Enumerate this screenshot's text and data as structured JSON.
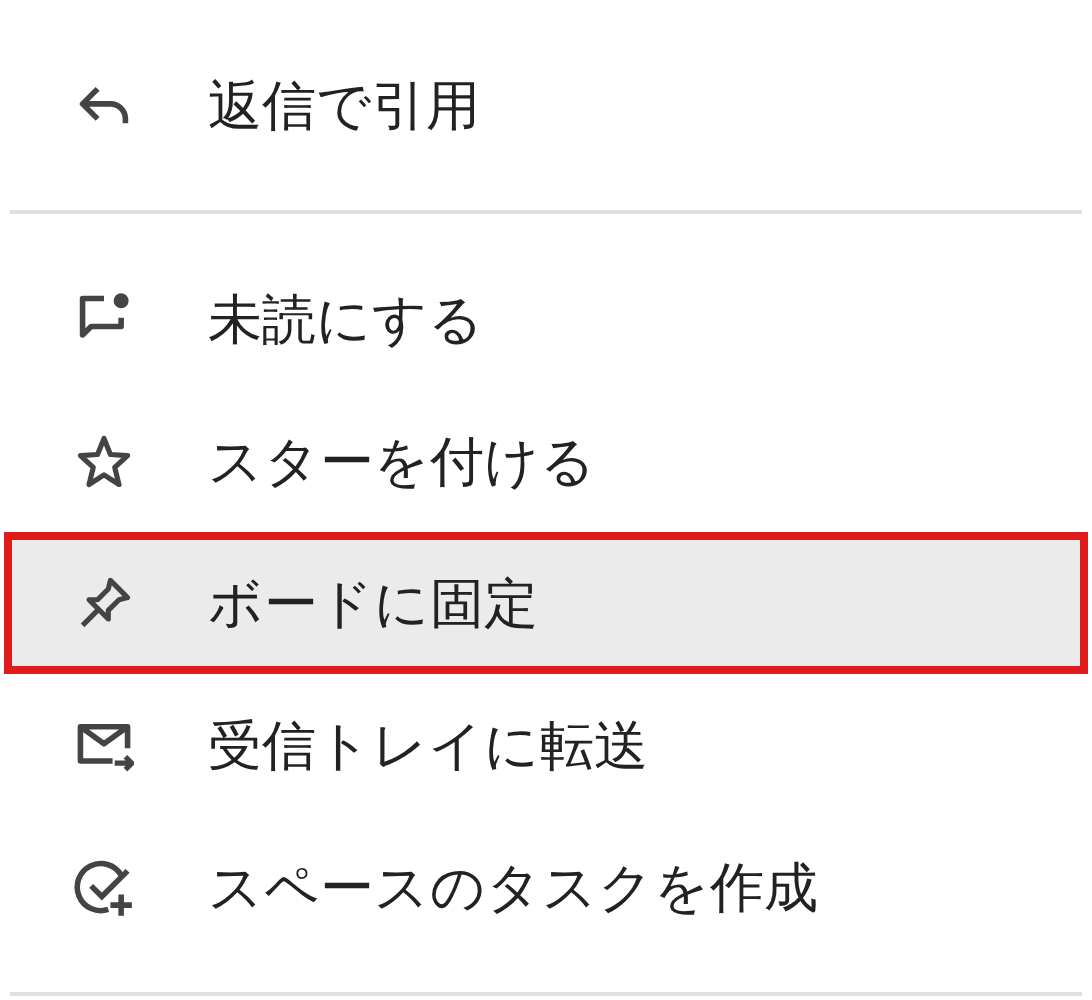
{
  "menu": {
    "sections": [
      {
        "items": [
          {
            "kind": "reply",
            "label": "返信で引用",
            "selected": false
          }
        ]
      },
      {
        "items": [
          {
            "kind": "unread",
            "label": "未読にする",
            "selected": false
          },
          {
            "kind": "star",
            "label": "スターを付ける",
            "selected": false
          },
          {
            "kind": "pin",
            "label": "ボードに固定",
            "selected": true
          },
          {
            "kind": "forward",
            "label": "受信トレイに転送",
            "selected": false
          },
          {
            "kind": "task",
            "label": "スペースのタスクを作成",
            "selected": false
          }
        ]
      }
    ]
  }
}
